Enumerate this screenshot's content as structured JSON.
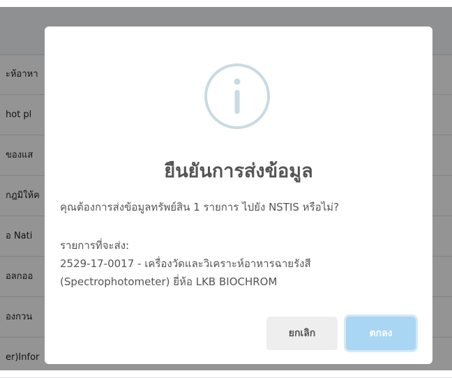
{
  "background_table": {
    "rows": [
      "ะห้อาหา",
      "hot pl",
      "ของแส",
      "กฎมิให้ค",
      "อ Nati",
      "อลกออ",
      "องกวน",
      "er)Infor"
    ]
  },
  "modal": {
    "icon": "info-icon",
    "title": "ยืนยันการส่งข้อมูล",
    "question": "คุณต้องการส่งข้อมูลทรัพย์สิน 1 รายการ ไปยัง NSTIS หรือไม่?",
    "detail_label": "รายการที่จะส่ง:",
    "detail_lines": [
      "2529-17-0017 - เครื่องวัดและวิเคราะห์อาหารฉายรังสี",
      "(Spectrophotometer) ยี่ห้อ LKB BIOCHROM"
    ],
    "cancel_label": "ยกเลิก",
    "confirm_label": "ตกลง"
  },
  "colors": {
    "icon": "#c9dae1",
    "title": "#545454",
    "confirm_button": "#a9d6f2",
    "cancel_button": "#eeeeee"
  }
}
